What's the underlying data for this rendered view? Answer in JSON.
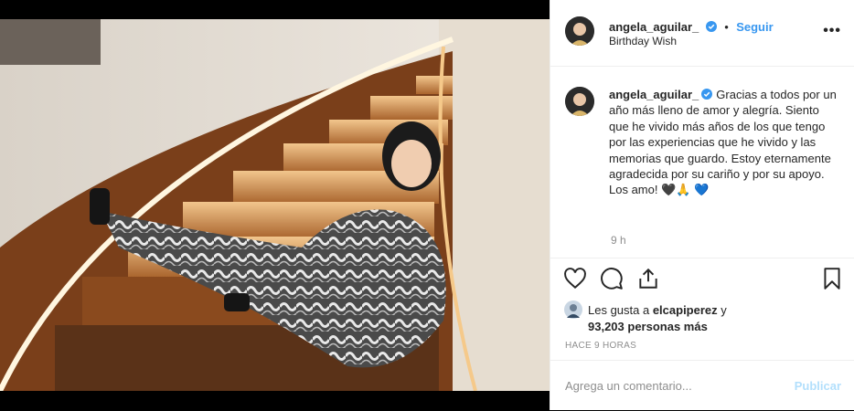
{
  "post": {
    "username": "angela_aguilar_",
    "follow_label": "Seguir",
    "dot": "•",
    "location": "Birthday Wish",
    "more_label": "•••",
    "caption_user": "angela_aguilar_",
    "caption_text": "Gracias a todos por un año más lleno de amor y alegría. Siento que he vivido más años de los que tengo por las experiencias que he vivido y las memorias que guardo. Estoy eternamente agradecida por su cariño y por su apoyo. Los amo! 🖤🙏 💙",
    "caption_time": "9 h",
    "likes_prefix": "Les gusta a ",
    "likes_user": "elcapiperez",
    "likes_mid": " y",
    "likes_count": "93,203 personas más",
    "time_ago": "HACE 9 HORAS",
    "comment_placeholder": "Agrega un comentario...",
    "publish_label": "Publicar"
  },
  "colors": {
    "accent": "#3897f0",
    "publish_disabled": "#b2dffc",
    "muted": "#8e8e8e",
    "text": "#262626"
  },
  "icons": [
    "verified-badge-icon",
    "more-options-icon",
    "heart-icon",
    "comment-icon",
    "share-icon",
    "bookmark-icon"
  ]
}
